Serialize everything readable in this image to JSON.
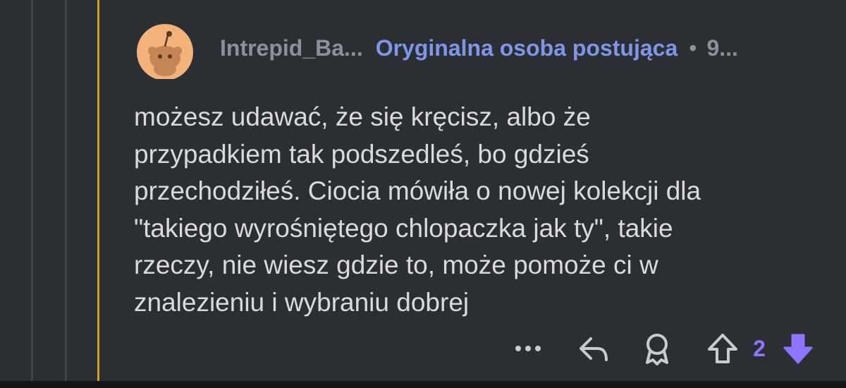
{
  "comment": {
    "username": "Intrepid_Ba...",
    "op_label": "Oryginalna osoba postująca",
    "separator": "•",
    "time": "9...",
    "body_lines": [
      "możesz udawać, że się kręcisz, albo że",
      "przypadkiem tak podszedleś, bo gdzieś",
      "przechodziłeś. Ciocia mówiła o nowej kolekcji dla",
      "\"takiego wyrośniętego chlopaczka jak ty\", takie",
      "rzeczy, nie wiesz gdzie to, może pomoże ci w",
      "znalezieniu i wybraniu dobrej"
    ],
    "score": "2"
  },
  "actions": {
    "more_icon": "more-icon",
    "reply_icon": "reply-icon",
    "award_icon": "award-icon",
    "upvote_icon": "upvote-icon",
    "downvote_icon": "downvote-icon"
  },
  "colors": {
    "background": "#2b2e33",
    "thread_active": "#d4a017",
    "op_label": "#7e96e8",
    "vote_accent": "#8f74ff",
    "text": "#d9dadc",
    "muted": "#8b9199"
  }
}
